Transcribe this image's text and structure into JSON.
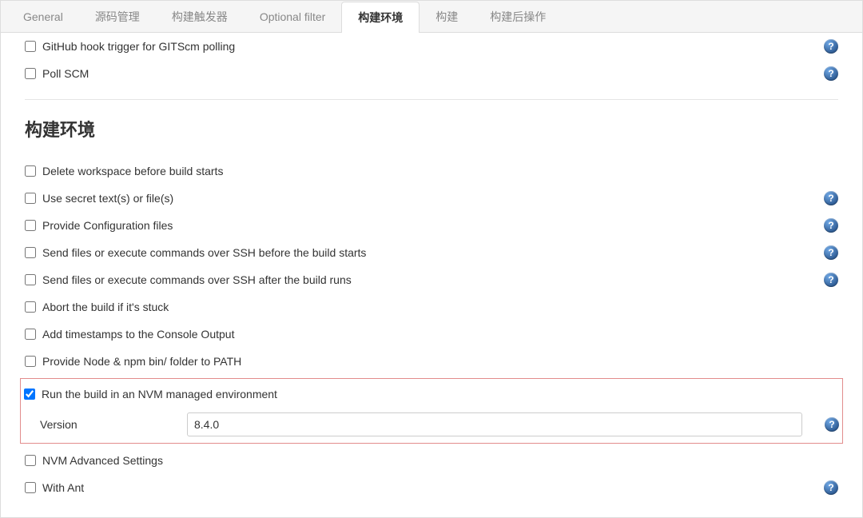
{
  "tabs": {
    "general": "General",
    "scm": "源码管理",
    "triggers": "构建触发器",
    "optional": "Optional filter",
    "env": "构建环境",
    "build": "构建",
    "post": "构建后操作"
  },
  "triggers_section": {
    "github_hook": {
      "label": "GitHub hook trigger for GITScm polling",
      "checked": false
    },
    "poll_scm": {
      "label": "Poll SCM",
      "checked": false
    }
  },
  "env_section": {
    "title": "构建环境",
    "items": {
      "delete_ws": {
        "label": "Delete workspace before build starts",
        "checked": false
      },
      "secret": {
        "label": "Use secret text(s) or file(s)",
        "checked": false
      },
      "config_files": {
        "label": "Provide Configuration files",
        "checked": false
      },
      "ssh_before": {
        "label": "Send files or execute commands over SSH before the build starts",
        "checked": false
      },
      "ssh_after": {
        "label": "Send files or execute commands over SSH after the build runs",
        "checked": false
      },
      "abort": {
        "label": "Abort the build if it's stuck",
        "checked": false
      },
      "timestamps": {
        "label": "Add timestamps to the Console Output",
        "checked": false
      },
      "node_path": {
        "label": "Provide Node & npm bin/ folder to PATH",
        "checked": false
      },
      "nvm_env": {
        "label": "Run the build in an NVM managed environment",
        "checked": true
      },
      "version_label": "Version",
      "version_value": "8.4.0",
      "nvm_adv": {
        "label": "NVM Advanced Settings",
        "checked": false
      },
      "with_ant": {
        "label": "With Ant",
        "checked": false
      }
    }
  },
  "help_glyph": "?"
}
